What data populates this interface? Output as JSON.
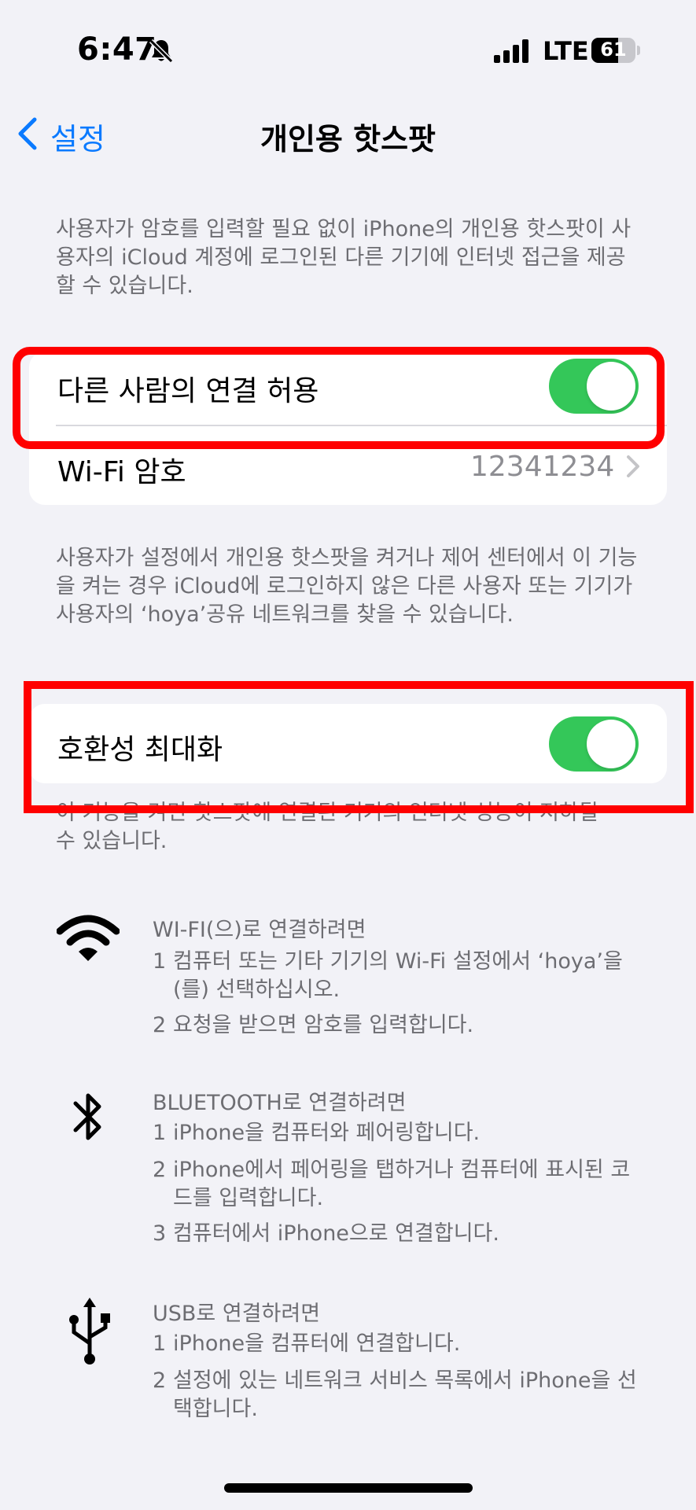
{
  "status_bar": {
    "time": "6:47",
    "network": "LTE",
    "battery_level": "61",
    "battery_fraction": 0.61
  },
  "nav": {
    "back_label": "설정",
    "title": "개인용 핫스팟"
  },
  "intro_text": "사용자가 암호를 입력할 필요 없이 iPhone의 개인용 핫스팟이 사용자의 iCloud 계정에 로그인된 다른 기기에 인터넷 접근을 제공할 수 있습니다.",
  "settings": {
    "allow_others": {
      "label": "다른 사람의 연결 허용",
      "on": true
    },
    "wifi_password": {
      "label": "Wi-Fi 암호",
      "value": "12341234"
    }
  },
  "discover_text": "사용자가 설정에서 개인용 핫스팟을 켜거나 제어 센터에서 이 기능을 켜는 경우 iCloud에 로그인하지 않은 다른 사용자 또는 기기가 사용자의 ‘hoya’공유 네트워크를 찾을 수 있습니다.",
  "compat": {
    "label": "호환성 최대화",
    "on": true,
    "footnote_line1": "이 기능을 켜면 핫스팟에 연결된 기기의 인터넷 성능이 저하될",
    "footnote_line2": "수 있습니다."
  },
  "instructions": {
    "wifi": {
      "icon": "wifi-icon",
      "heading": "WI-FI(으)로 연결하려면",
      "steps": [
        {
          "n": "1",
          "text": "컴퓨터 또는 기타 기기의 Wi-Fi 설정에서 ‘hoya’을(를) 선택하십시오."
        },
        {
          "n": "2",
          "text": "요청을 받으면 암호를 입력합니다."
        }
      ]
    },
    "bluetooth": {
      "icon": "bluetooth-icon",
      "heading": "BLUETOOTH로 연결하려면",
      "steps": [
        {
          "n": "1",
          "text": "iPhone을 컴퓨터와 페어링합니다."
        },
        {
          "n": "2",
          "text": "iPhone에서 페어링을 탭하거나 컴퓨터에 표시된 코드를 입력합니다."
        },
        {
          "n": "3",
          "text": "컴퓨터에서 iPhone으로 연결합니다."
        }
      ]
    },
    "usb": {
      "icon": "usb-icon",
      "heading": "USB로 연결하려면",
      "steps": [
        {
          "n": "1",
          "text": "iPhone을 컴퓨터에 연결합니다."
        },
        {
          "n": "2",
          "text": "설정에 있는 네트워크 서비스 목록에서 iPhone을 선택합니다."
        }
      ]
    }
  },
  "colors": {
    "accent": "#0a7aff",
    "toggle_on": "#34c759",
    "highlight": "#ff0000",
    "background": "#f2f2f7",
    "secondary_text": "#6d6d72"
  }
}
